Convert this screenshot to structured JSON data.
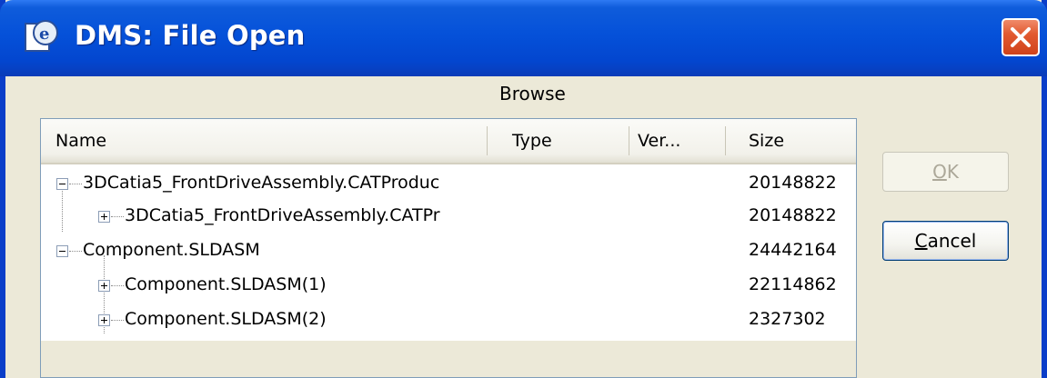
{
  "window": {
    "title": "DMS: File Open"
  },
  "browse": {
    "label": "Browse"
  },
  "columns": {
    "name": "Name",
    "type": "Type",
    "version": "Ver...",
    "size": "Size"
  },
  "rows": [
    {
      "name": "3DCatia5_FrontDriveAssembly.CATProduc",
      "size": "20148822",
      "expander": "minus"
    },
    {
      "name": "3DCatia5_FrontDriveAssembly.CATPr",
      "size": "20148822",
      "expander": "plus"
    },
    {
      "name": "Component.SLDASM",
      "size": "24442164",
      "expander": "minus"
    },
    {
      "name": "Component.SLDASM(1)",
      "size": "22114862",
      "expander": "plus"
    },
    {
      "name": "Component.SLDASM(2)",
      "size": "2327302",
      "expander": "plus"
    }
  ],
  "buttons": {
    "ok_label_first": "O",
    "ok_label_rest": "K",
    "cancel_label_first": "C",
    "cancel_label_rest": "ancel"
  },
  "icons": {
    "app": "dms-app-icon",
    "close": "close-icon",
    "expand": "plus-box-icon",
    "collapse": "minus-box-icon"
  },
  "colors": {
    "titlebar": "#0551d9",
    "close_button": "#e25a31",
    "dialog_bg": "#ece9d8"
  }
}
